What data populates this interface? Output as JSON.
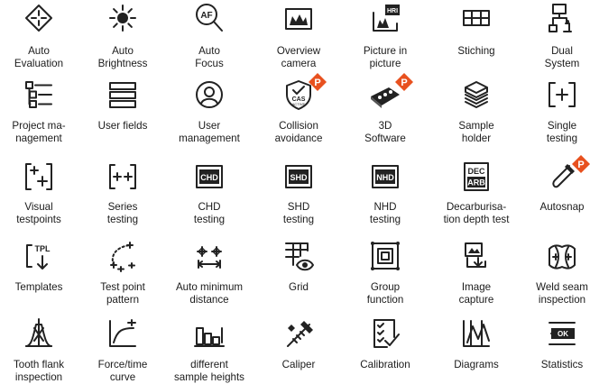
{
  "accent_color": "#e8511f",
  "pro_badge_letter": "P",
  "rows": [
    [
      {
        "id": "auto-evaluation",
        "icon": "diamond-target-icon",
        "lines": [
          "Auto",
          "Evaluation"
        ]
      },
      {
        "id": "auto-brightness",
        "icon": "sun-icon",
        "lines": [
          "Auto",
          "Brightness"
        ]
      },
      {
        "id": "auto-focus",
        "icon": "magnifier-af-icon",
        "icon_text": "AF",
        "lines": [
          "Auto",
          "Focus"
        ]
      },
      {
        "id": "overview-camera",
        "icon": "overview-camera-icon",
        "lines": [
          "Overview",
          "camera"
        ]
      },
      {
        "id": "picture-in-picture",
        "icon": "picture-in-picture-icon",
        "icon_text": "HRI",
        "lines": [
          "Picture in",
          "picture"
        ]
      },
      {
        "id": "stiching",
        "icon": "stitch-grid-icon",
        "lines": [
          "Stiching"
        ]
      },
      {
        "id": "dual-system",
        "icon": "dual-system-icon",
        "lines": [
          "Dual",
          "System"
        ]
      }
    ],
    [
      {
        "id": "project-management",
        "icon": "project-list-icon",
        "lines": [
          "Project ma-",
          "nagement"
        ]
      },
      {
        "id": "user-fields",
        "icon": "user-fields-icon",
        "lines": [
          "User fields"
        ]
      },
      {
        "id": "user-management",
        "icon": "user-circle-icon",
        "lines": [
          "User",
          "management"
        ]
      },
      {
        "id": "collision-avoidance",
        "icon": "shield-check-icon",
        "icon_text": "CAS",
        "sub_text": "ACTIVE",
        "pro": true,
        "lines": [
          "Collision",
          "avoidance"
        ]
      },
      {
        "id": "3d-software",
        "icon": "3d-specimen-icon",
        "pro": true,
        "lines": [
          "3D",
          "Software"
        ]
      },
      {
        "id": "sample-holder",
        "icon": "sample-holder-icon",
        "lines": [
          "Sample",
          "holder"
        ]
      },
      {
        "id": "single-testing",
        "icon": "single-plus-icon",
        "lines": [
          "Single",
          "testing"
        ]
      }
    ],
    [
      {
        "id": "visual-testpoints",
        "icon": "visual-plus-icon",
        "lines": [
          "Visual",
          "testpoints"
        ]
      },
      {
        "id": "series-testing",
        "icon": "series-plus-icon",
        "lines": [
          "Series",
          "testing"
        ]
      },
      {
        "id": "chd-testing",
        "icon": "chd-icon",
        "icon_text": "CHD",
        "lines": [
          "CHD",
          "testing"
        ]
      },
      {
        "id": "shd-testing",
        "icon": "shd-icon",
        "icon_text": "SHD",
        "lines": [
          "SHD",
          "testing"
        ]
      },
      {
        "id": "nhd-testing",
        "icon": "nhd-icon",
        "icon_text": "NHD",
        "lines": [
          "NHD",
          "testing"
        ]
      },
      {
        "id": "decarburisation",
        "icon": "dec-arb-icon",
        "icon_text": "DEC",
        "icon_text2": "ARB",
        "lines": [
          "Decarburisa-",
          "tion depth test"
        ]
      },
      {
        "id": "autosnap",
        "icon": "magnet-icon",
        "pro": true,
        "lines": [
          "Autosnap"
        ]
      }
    ],
    [
      {
        "id": "templates",
        "icon": "template-tpl-icon",
        "icon_text": "TPL",
        "lines": [
          "Templates"
        ]
      },
      {
        "id": "test-point-pattern",
        "icon": "pattern-arc-icon",
        "lines": [
          "Test point",
          "pattern"
        ]
      },
      {
        "id": "auto-minimum-distance",
        "icon": "min-distance-icon",
        "lines": [
          "Auto minimum",
          "distance"
        ]
      },
      {
        "id": "grid",
        "icon": "grid-eye-icon",
        "lines": [
          "Grid"
        ]
      },
      {
        "id": "group-function",
        "icon": "group-squares-icon",
        "lines": [
          "Group",
          "function"
        ]
      },
      {
        "id": "image-capture",
        "icon": "image-capture-icon",
        "lines": [
          "Image",
          "capture"
        ]
      },
      {
        "id": "weld-seam-inspection",
        "icon": "weld-seam-icon",
        "lines": [
          "Weld seam",
          "inspection"
        ]
      }
    ],
    [
      {
        "id": "tooth-flank-inspection",
        "icon": "tooth-flank-icon",
        "lines": [
          "Tooth flank",
          "inspection"
        ]
      },
      {
        "id": "force-time-curve",
        "icon": "force-curve-icon",
        "lines": [
          "Force/time",
          "curve"
        ]
      },
      {
        "id": "different-sample-heights",
        "icon": "sample-heights-icon",
        "lines": [
          "different",
          "sample heights"
        ]
      },
      {
        "id": "caliper",
        "icon": "caliper-icon",
        "lines": [
          "Caliper"
        ]
      },
      {
        "id": "calibration",
        "icon": "checklist-icon",
        "lines": [
          "Calibration"
        ]
      },
      {
        "id": "diagrams",
        "icon": "diagram-icon",
        "lines": [
          "Diagrams"
        ]
      },
      {
        "id": "statistics",
        "icon": "statistics-ok-icon",
        "icon_text": "OK",
        "lines": [
          "Statistics"
        ]
      }
    ]
  ]
}
